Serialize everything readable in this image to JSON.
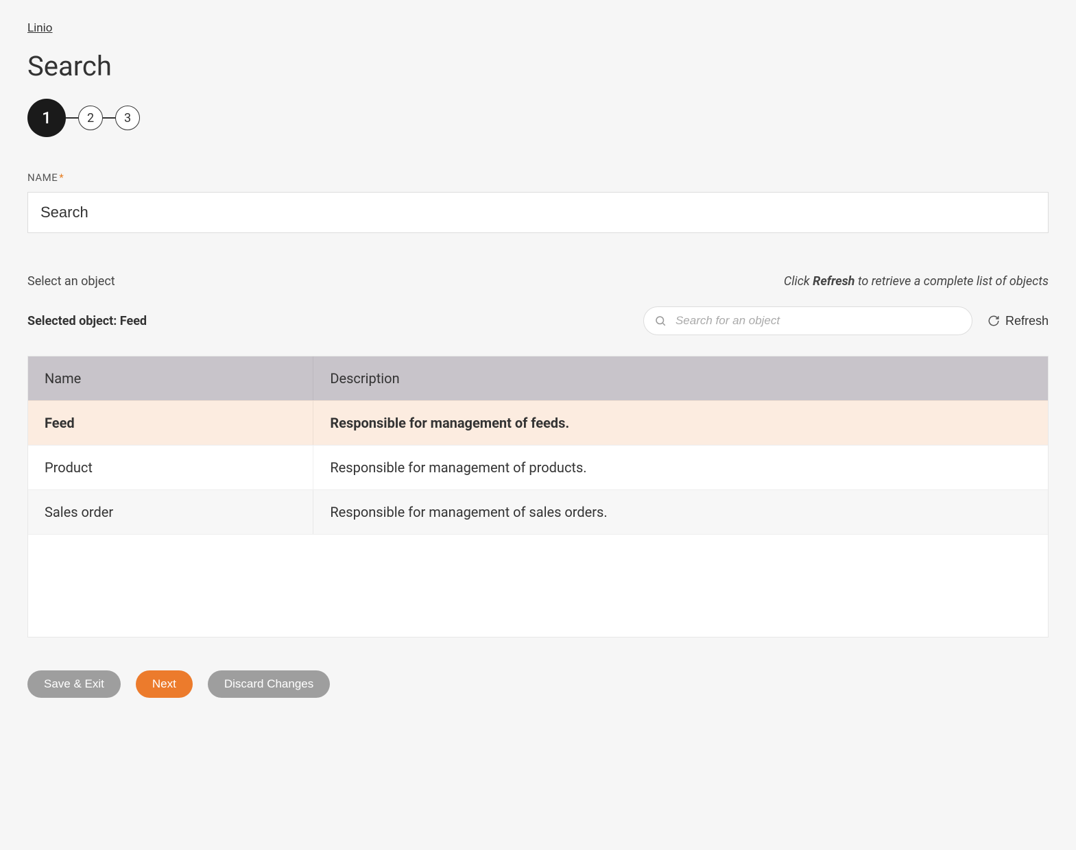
{
  "breadcrumb": {
    "label": "Linio"
  },
  "page": {
    "title": "Search"
  },
  "stepper": {
    "steps": [
      "1",
      "2",
      "3"
    ],
    "active_index": 0
  },
  "name_field": {
    "label": "NAME",
    "value": "Search"
  },
  "object_select": {
    "label": "Select an object",
    "hint_prefix": "Click ",
    "hint_bold": "Refresh",
    "hint_suffix": " to retrieve a complete list of objects",
    "selected_prefix": "Selected object: ",
    "selected_value": "Feed",
    "search_placeholder": "Search for an object",
    "refresh_label": "Refresh"
  },
  "table": {
    "columns": {
      "name": "Name",
      "description": "Description"
    },
    "rows": [
      {
        "name": "Feed",
        "description": "Responsible for management of feeds.",
        "selected": true
      },
      {
        "name": "Product",
        "description": "Responsible for management of products.",
        "selected": false
      },
      {
        "name": "Sales order",
        "description": "Responsible for management of sales orders.",
        "selected": false
      }
    ]
  },
  "footer": {
    "save_exit": "Save & Exit",
    "next": "Next",
    "discard": "Discard Changes"
  }
}
